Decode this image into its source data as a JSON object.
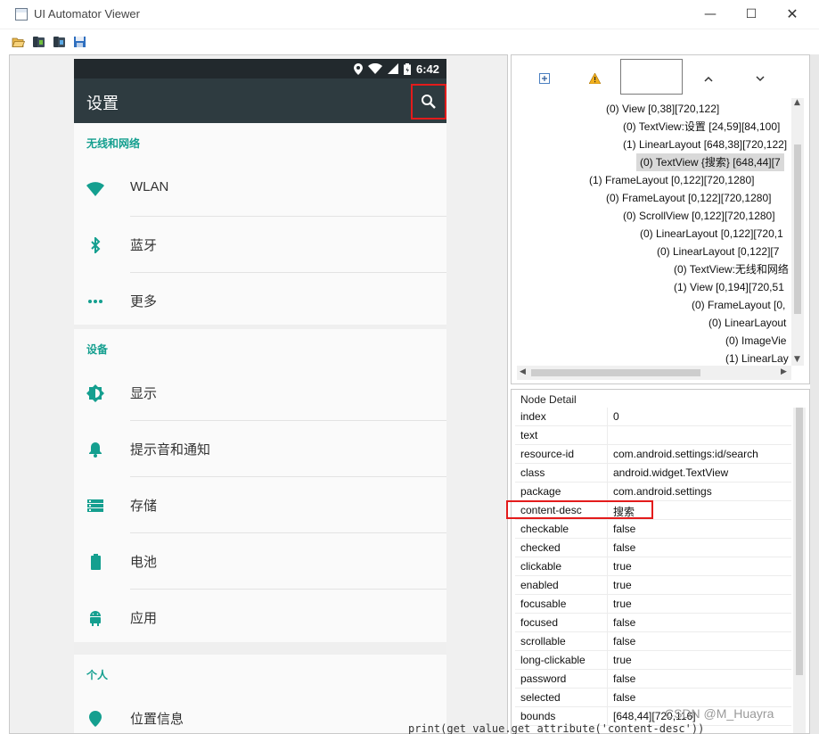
{
  "window": {
    "title": "UI Automator Viewer",
    "minimize_glyph": "—",
    "maximize_glyph": "☐",
    "close_glyph": "✕"
  },
  "toolbar": {
    "icons": [
      "open-folder-icon",
      "device-screenshot-icon",
      "device-screenshot-compressed-icon",
      "save-icon"
    ]
  },
  "device": {
    "status_time": "6:42",
    "app_title": "设置",
    "sections": [
      {
        "title": "无线和网络",
        "items": [
          {
            "label": "WLAN",
            "icon": "wifi-icon"
          },
          {
            "label": "蓝牙",
            "icon": "bluetooth-icon"
          },
          {
            "label": "更多",
            "icon": "more-icon"
          }
        ]
      },
      {
        "title": "设备",
        "items": [
          {
            "label": "显示",
            "icon": "brightness-icon"
          },
          {
            "label": "提示音和通知",
            "icon": "bell-icon"
          },
          {
            "label": "存储",
            "icon": "storage-icon"
          },
          {
            "label": "电池",
            "icon": "battery-icon"
          },
          {
            "label": "应用",
            "icon": "android-icon"
          }
        ]
      },
      {
        "title": "个人",
        "items": [
          {
            "label": "位置信息",
            "icon": "location-icon"
          }
        ]
      }
    ],
    "accent_color": "#149f8f"
  },
  "tree": {
    "rows": [
      "(0) View [0,38][720,122]",
      "(0) TextView:设置 [24,59][84,100]",
      "(1) LinearLayout [648,38][720,122]",
      "(0) TextView {搜索} [648,44][7",
      "(1) FrameLayout [0,122][720,1280]",
      "(0) FrameLayout [0,122][720,1280]",
      "(0) ScrollView [0,122][720,1280]",
      "(0) LinearLayout [0,122][720,1",
      "(0) LinearLayout [0,122][7",
      "(0) TextView:无线和网络",
      "(1) View [0,194][720,51",
      "(0) FrameLayout [0,",
      "(0) LinearLayout",
      "(0) ImageVie",
      "(1) LinearLay"
    ]
  },
  "node_detail": {
    "title": "Node Detail",
    "rows": [
      {
        "key": "index",
        "value": "0"
      },
      {
        "key": "text",
        "value": ""
      },
      {
        "key": "resource-id",
        "value": "com.android.settings:id/search"
      },
      {
        "key": "class",
        "value": "android.widget.TextView"
      },
      {
        "key": "package",
        "value": "com.android.settings"
      },
      {
        "key": "content-desc",
        "value": "搜索"
      },
      {
        "key": "checkable",
        "value": "false"
      },
      {
        "key": "checked",
        "value": "false"
      },
      {
        "key": "clickable",
        "value": "true"
      },
      {
        "key": "enabled",
        "value": "true"
      },
      {
        "key": "focusable",
        "value": "true"
      },
      {
        "key": "focused",
        "value": "false"
      },
      {
        "key": "scrollable",
        "value": "false"
      },
      {
        "key": "long-clickable",
        "value": "true"
      },
      {
        "key": "password",
        "value": "false"
      },
      {
        "key": "selected",
        "value": "false"
      },
      {
        "key": "bounds",
        "value": "[648,44][720,116]"
      }
    ]
  },
  "watermark": "CSDN @M_Huayra",
  "code_snippet": "print(get_value.get_attribute('content-desc'))",
  "highlight_color": "#e31b1b"
}
